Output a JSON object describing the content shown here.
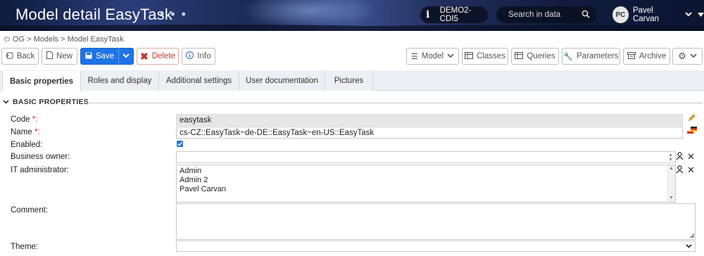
{
  "header": {
    "title": "Model detail EasyTask",
    "more_icon": "ellipsis-icon",
    "environment": "DEMO2-CDI5",
    "search_placeholder": "Search in data",
    "user_initials": "PC",
    "user_name": "Pavel Carvan"
  },
  "breadcrumb": {
    "text": "OG > Models > Model EasyTask"
  },
  "toolbar": {
    "back": "Back",
    "new": "New",
    "save": "Save",
    "delete": "Delete",
    "info": "Info",
    "model": "Model",
    "classes": "Classes",
    "queries": "Queries",
    "parameters": "Parameters",
    "archive": "Archive"
  },
  "tabs": [
    {
      "label": "Basic properties"
    },
    {
      "label": "Roles and display"
    },
    {
      "label": "Additional settings"
    },
    {
      "label": "User documentation"
    },
    {
      "label": "Pictures"
    }
  ],
  "section": {
    "title": "BASIC PROPERTIES"
  },
  "form": {
    "code_label": "Code ",
    "code_required": "*:",
    "code_value": "easytask",
    "name_label": "Name ",
    "name_required": "*:",
    "name_value": "cs-CZ::EasyTask~de-DE::EasyTask~en-US::EasyTask",
    "enabled_label": "Enabled:",
    "enabled_checked": true,
    "business_owner_label": "Business owner:",
    "business_owner_value": "",
    "it_admin_label": "IT administrator:",
    "it_admin_values": [
      "Admin",
      "Admin 2",
      "Pavel Carvan"
    ],
    "comment_label": "Comment:",
    "comment_value": "",
    "theme_label": "Theme:",
    "theme_value": ""
  },
  "colors": {
    "primary": "#1e74e6",
    "danger": "#c0392b",
    "required": "#d0201f"
  }
}
